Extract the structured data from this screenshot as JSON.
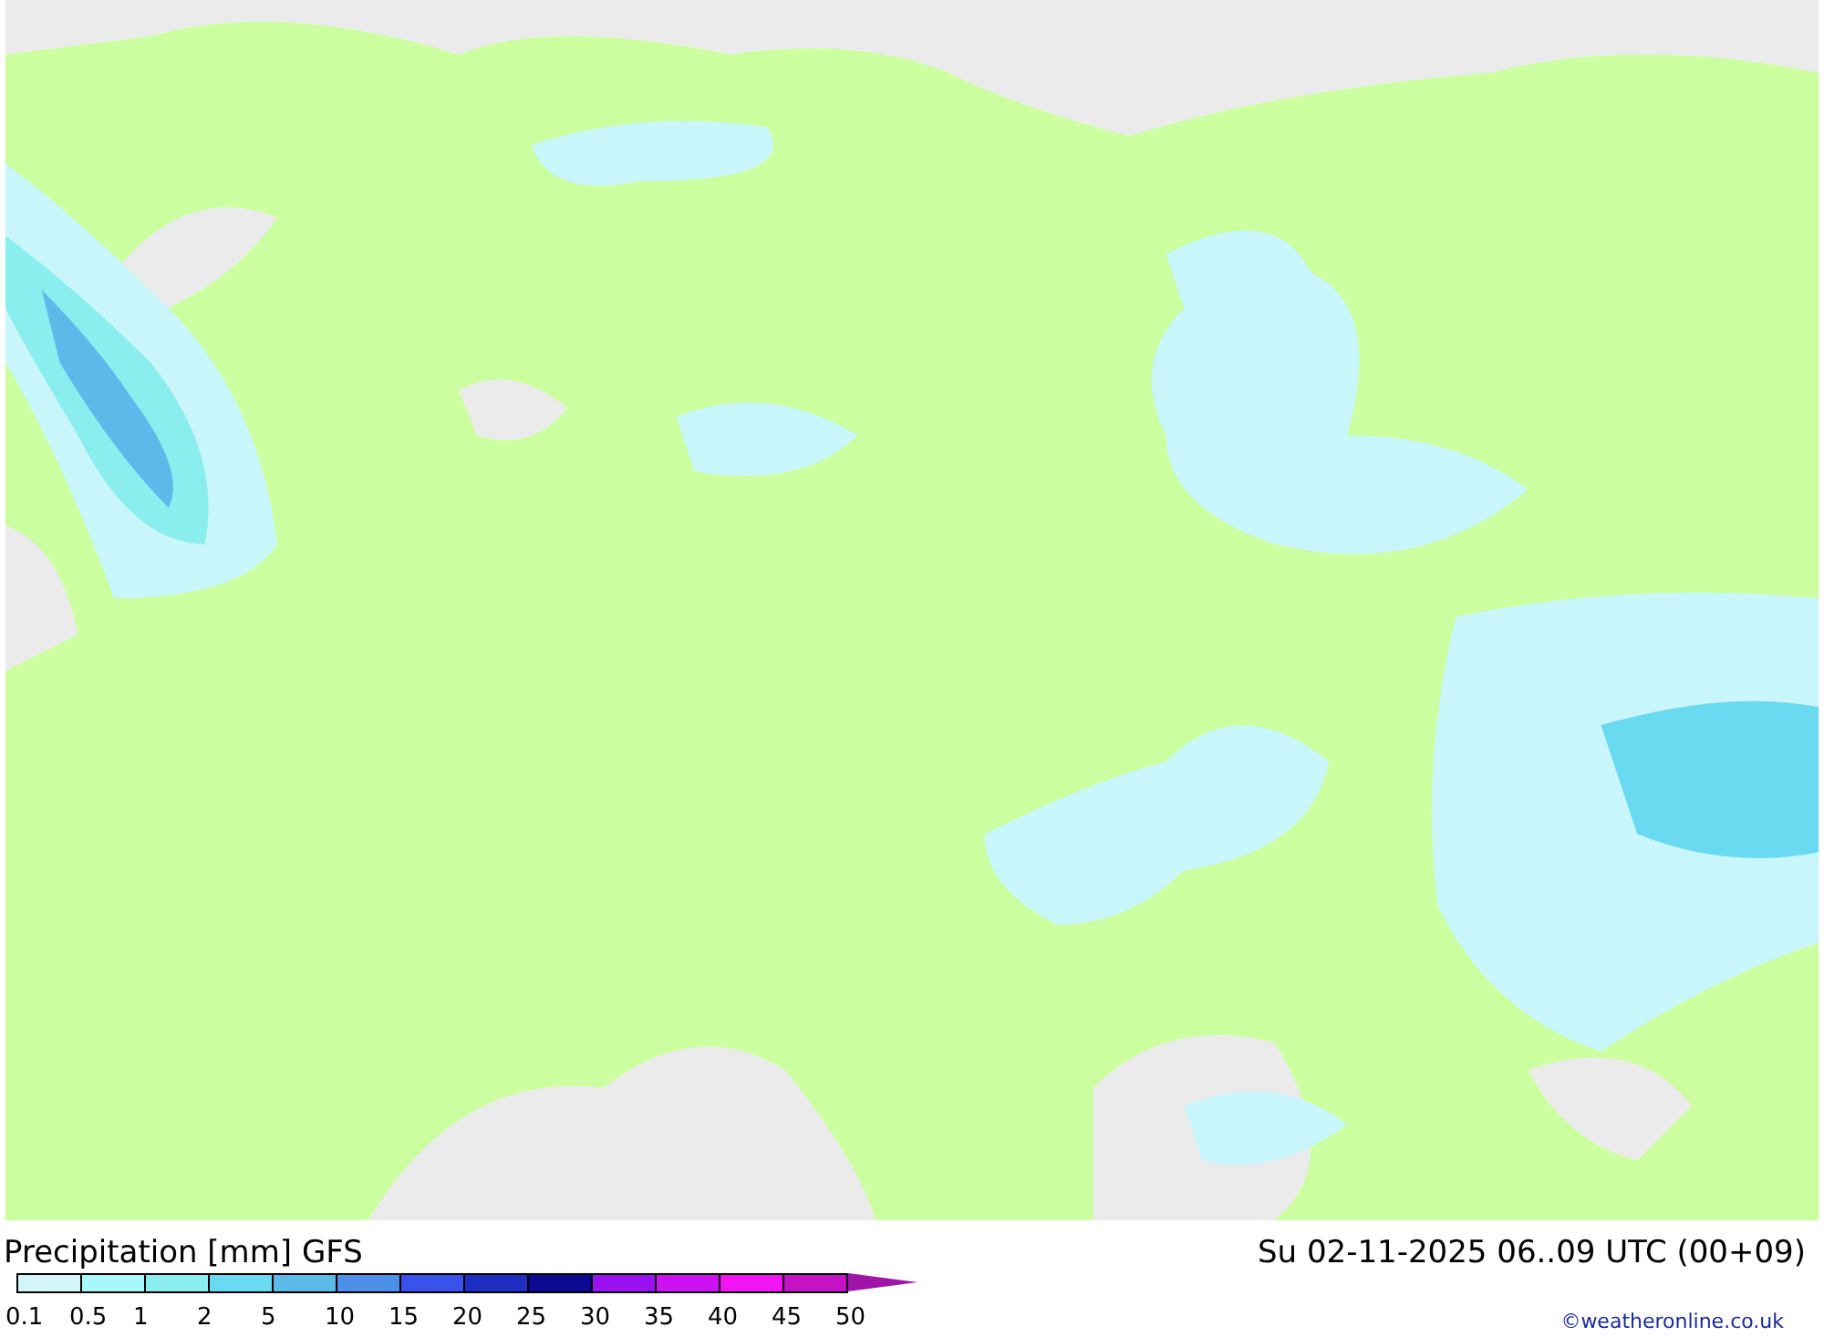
{
  "legend": {
    "title": "Precipitation [mm] GFS",
    "valid_time": "Su 02-11-2025 06..09 UTC (00+09)",
    "copyright": "©weatheronline.co.uk",
    "scale": [
      {
        "label": "0.1",
        "color": "#d2f6f8"
      },
      {
        "label": "0.5",
        "color": "#a6f8fa"
      },
      {
        "label": "1",
        "color": "#8aeeee"
      },
      {
        "label": "2",
        "color": "#6adaf0"
      },
      {
        "label": "5",
        "color": "#5cbaea"
      },
      {
        "label": "10",
        "color": "#4c90ea"
      },
      {
        "label": "15",
        "color": "#3a52ec"
      },
      {
        "label": "20",
        "color": "#1e2ec2"
      },
      {
        "label": "25",
        "color": "#0c0a92"
      },
      {
        "label": "30",
        "color": "#9a12f2"
      },
      {
        "label": "35",
        "color": "#cc12f2"
      },
      {
        "label": "40",
        "color": "#f214f2"
      },
      {
        "label": "45",
        "color": "#c412c4"
      },
      {
        "label": "50",
        "color": "#a014a8"
      }
    ]
  }
}
